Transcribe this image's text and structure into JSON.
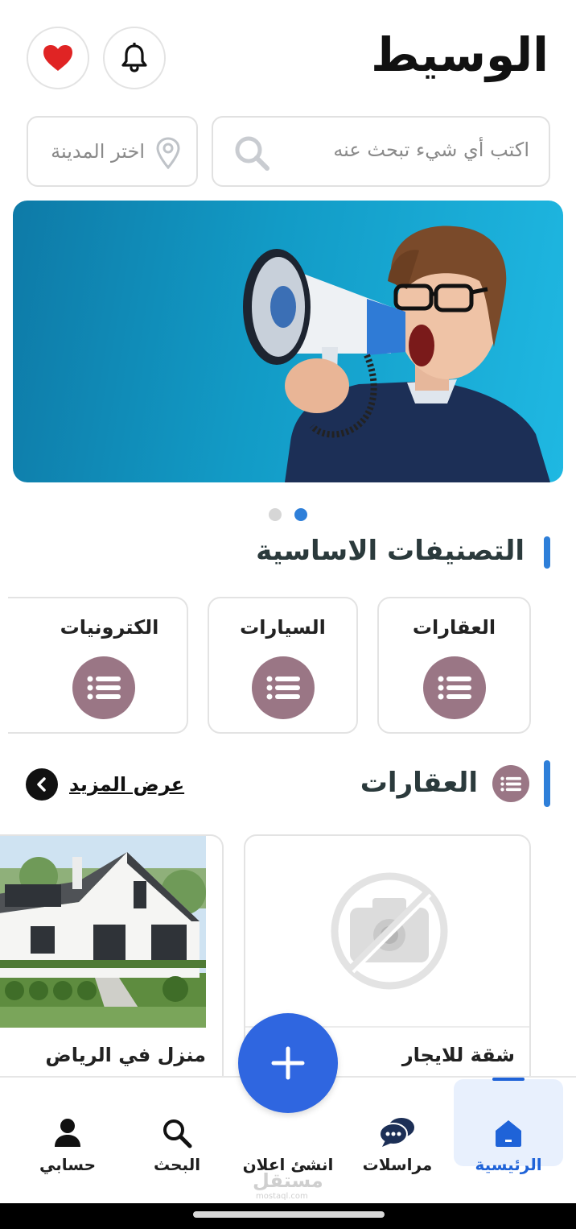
{
  "header": {
    "title": "الوسيط",
    "favorites_icon": "heart-icon",
    "notifications_icon": "bell-icon"
  },
  "search": {
    "query_placeholder": "اكتب أي شيء تبحث عنه",
    "city_placeholder": "اختر المدينة"
  },
  "banner": {
    "slides_count": 2,
    "active_slide": 2
  },
  "categories_section": {
    "title": "التصنيفات الاساسية",
    "items": [
      {
        "label": "العقارات",
        "icon": "list-icon"
      },
      {
        "label": "السيارات",
        "icon": "list-icon"
      },
      {
        "label": "الكترونيات",
        "icon": "list-icon"
      }
    ]
  },
  "real_estate_section": {
    "title": "العقارات",
    "show_more": "عرض المزيد",
    "listings": [
      {
        "title": "شقة للايجار",
        "image": "no-image-placeholder"
      },
      {
        "title": "منزل في الرياض",
        "image": "house-photo"
      }
    ]
  },
  "bottom_nav": {
    "items": [
      {
        "label": "الرئيسية",
        "icon": "home-icon",
        "active": true
      },
      {
        "label": "مراسلات",
        "icon": "chat-icon",
        "active": false
      },
      {
        "label": "انشئ اعلان",
        "icon": "plus-icon",
        "active": false
      },
      {
        "label": "البحث",
        "icon": "search-icon",
        "active": false
      },
      {
        "label": "حسابي",
        "icon": "user-icon",
        "active": false
      }
    ]
  },
  "watermark": {
    "text": "مستقل",
    "sub": "mostaql.com"
  },
  "colors": {
    "accent": "#2f66e0",
    "section_bar": "#2e7fd9",
    "category_icon_bg": "#9a7685",
    "favorite": "#e02424",
    "active_nav_bg": "#e8f0fd",
    "active_nav_text": "#1f63d8"
  }
}
